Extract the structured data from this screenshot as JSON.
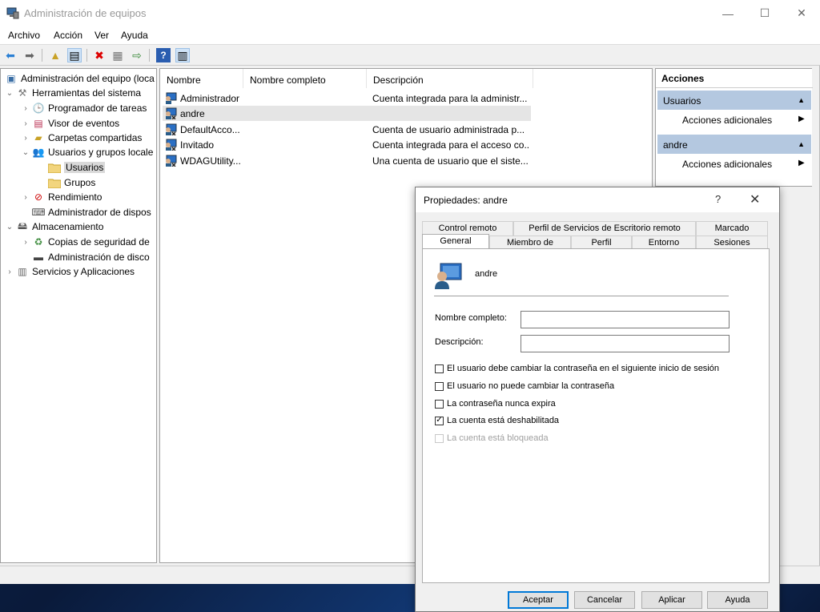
{
  "window": {
    "title": "Administración de equipos",
    "controls": {
      "minimize": "—",
      "maximize": "☐",
      "close": "✕"
    }
  },
  "menu": [
    "Archivo",
    "Acción",
    "Ver",
    "Ayuda"
  ],
  "tree": {
    "items": [
      {
        "label": "Administración del equipo (loca",
        "icon": "computer-management-icon"
      },
      {
        "label": "Herramientas del sistema",
        "icon": "tools-icon"
      },
      {
        "label": "Programador de tareas",
        "icon": "clock-icon"
      },
      {
        "label": "Visor de eventos",
        "icon": "event-viewer-icon"
      },
      {
        "label": "Carpetas compartidas",
        "icon": "shared-folder-icon"
      },
      {
        "label": "Usuarios y grupos locale",
        "icon": "users-group-icon"
      },
      {
        "label": "Usuarios",
        "icon": "folder-icon"
      },
      {
        "label": "Grupos",
        "icon": "folder-icon"
      },
      {
        "label": "Rendimiento",
        "icon": "performance-icon"
      },
      {
        "label": "Administrador de dispos",
        "icon": "device-manager-icon"
      },
      {
        "label": "Almacenamiento",
        "icon": "storage-icon"
      },
      {
        "label": "Copias de seguridad de",
        "icon": "backup-icon"
      },
      {
        "label": "Administración de disco",
        "icon": "disk-icon"
      },
      {
        "label": "Servicios y Aplicaciones",
        "icon": "services-icon"
      }
    ]
  },
  "list": {
    "columns": [
      "Nombre",
      "Nombre completo",
      "Descripción"
    ],
    "rows": [
      {
        "name": "Administrador",
        "fullname": "",
        "description": "Cuenta integrada para la administr..."
      },
      {
        "name": "andre",
        "fullname": "",
        "description": ""
      },
      {
        "name": "DefaultAcco...",
        "fullname": "",
        "description": "Cuenta de usuario administrada p..."
      },
      {
        "name": "Invitado",
        "fullname": "",
        "description": "Cuenta integrada para el acceso co..."
      },
      {
        "name": "WDAGUtility...",
        "fullname": "",
        "description": "Una cuenta de usuario que el siste..."
      }
    ]
  },
  "actions": {
    "header": "Acciones",
    "sections": [
      {
        "title": "Usuarios",
        "item": "Acciones adicionales"
      },
      {
        "title": "andre",
        "item": "Acciones adicionales"
      }
    ]
  },
  "dialog": {
    "title": "Propiedades: andre",
    "help": "?",
    "close": "✕",
    "tabs_row1": [
      "Control remoto",
      "Perfil de Servicios de Escritorio remoto",
      "Marcado"
    ],
    "tabs_row2": [
      "General",
      "Miembro de",
      "Perfil",
      "Entorno",
      "Sesiones"
    ],
    "username": "andre",
    "fullname_label": "Nombre completo:",
    "fullname_value": "",
    "description_label": "Descripción:",
    "description_value": "",
    "checkboxes": [
      {
        "label": "El usuario debe cambiar la contraseña en el siguiente inicio de sesión",
        "checked": false,
        "disabled": false
      },
      {
        "label": "El usuario no puede cambiar la contraseña",
        "checked": false,
        "disabled": false
      },
      {
        "label": "La contraseña nunca expira",
        "checked": false,
        "disabled": false
      },
      {
        "label": "La cuenta está deshabilitada",
        "checked": true,
        "disabled": false
      },
      {
        "label": "La cuenta está bloqueada",
        "checked": false,
        "disabled": true
      }
    ],
    "buttons": {
      "ok": "Aceptar",
      "cancel": "Cancelar",
      "apply": "Aplicar",
      "help": "Ayuda"
    }
  },
  "colors": {
    "accent": "#0078d7",
    "action_section": "#b4c8e0"
  }
}
